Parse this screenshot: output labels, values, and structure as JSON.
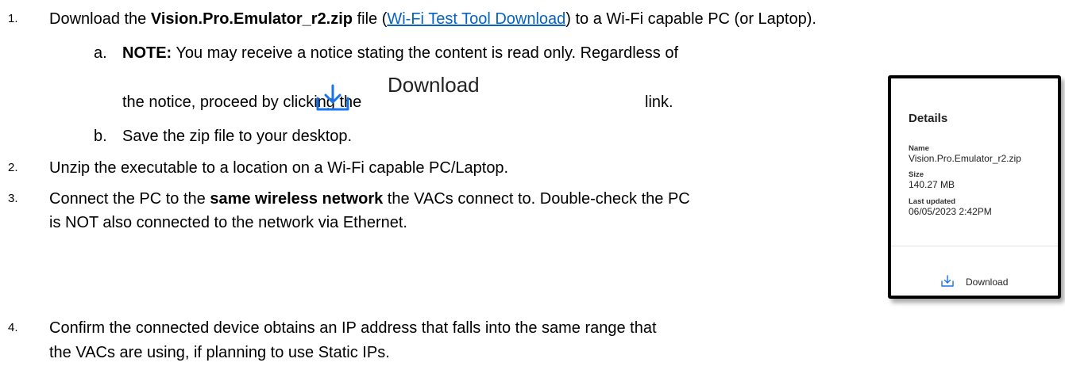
{
  "steps": [
    {
      "number": "1.",
      "text_pre": "Download the ",
      "bold": "Vision.Pro.Emulator_r2.zip",
      "text_mid": " file (",
      "link": "Wi-Fi Test Tool Download",
      "text_post": ") to a Wi-Fi capable PC (or Laptop).",
      "substeps": [
        {
          "letter": "a.",
          "bold": "NOTE:",
          "line1": " You may receive a notice stating the content is read only. Regardless of",
          "line2_pre": "the notice, proceed by clicking the",
          "inline_icon": "download-arrow-icon",
          "inline_label": "Download",
          "line2_post": "link."
        },
        {
          "letter": "b.",
          "text": "Save the zip file to your desktop."
        }
      ]
    },
    {
      "number": "2.",
      "text": "Unzip the executable to a location on a Wi-Fi capable PC/Laptop."
    },
    {
      "number": "3.",
      "text_pre": "Connect the PC to the ",
      "bold": "same wireless network",
      "text_post": " the VACs connect to. Double-check the PC",
      "line2": "is NOT also connected to the network via Ethernet."
    },
    {
      "number": "4.",
      "line1": "Confirm the connected device obtains an IP address that falls into the same range that",
      "line2": "the VACs are using, if planning to use Static IPs."
    }
  ],
  "details_panel": {
    "title": "Details",
    "name_label": "Name",
    "name_value": "Vision.Pro.Emulator_r2.zip",
    "size_label": "Size",
    "size_value": "140.27 MB",
    "updated_label": "Last updated",
    "updated_value": "06/05/2023 2:42PM",
    "download_icon": "download-arrow-icon",
    "download_label": "Download"
  },
  "colors": {
    "link": "#0563c1",
    "icon_blue": "#1a73e8"
  }
}
